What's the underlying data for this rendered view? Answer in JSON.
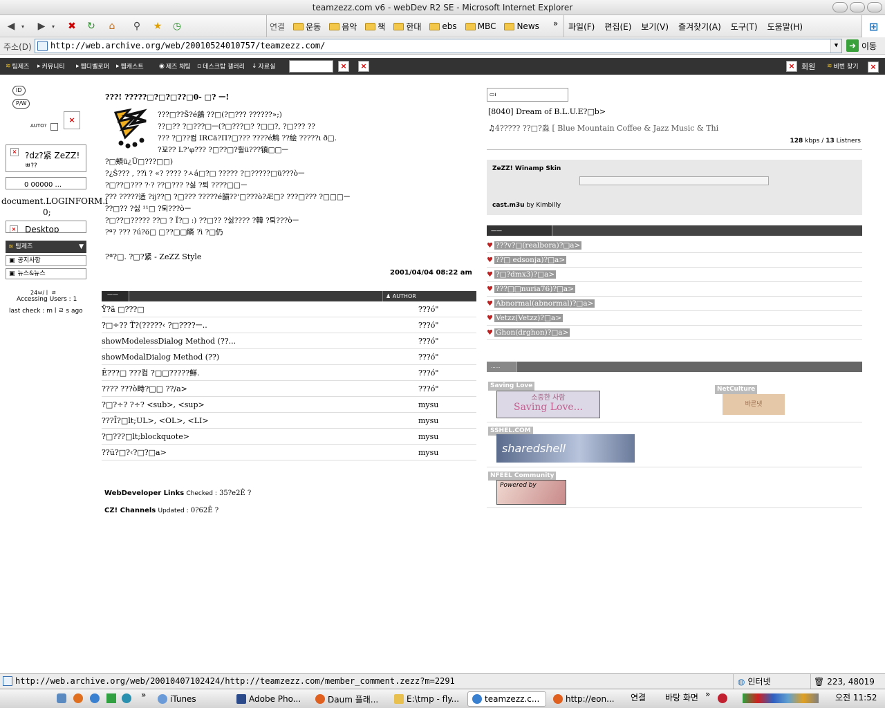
{
  "window": {
    "title": "teamzezz.com v6 - webDev R2 SE - Microsoft Internet Explorer"
  },
  "links_bar": {
    "label": "연결",
    "items": [
      "운동",
      "음악",
      "책",
      "한대",
      "ebs",
      "MBC",
      "News"
    ],
    "more": "»"
  },
  "menu": [
    "파일(F)",
    "편집(E)",
    "보기(V)",
    "즐겨찾기(A)",
    "도구(T)",
    "도움말(H)"
  ],
  "address": {
    "label": "주소(D)",
    "url": "http://web.archive.org/web/20010524010757/teamzezz.com/",
    "go": "이동"
  },
  "site_nav": {
    "items": [
      "팀제즈",
      "커뮤니티",
      "웹디벨로퍼",
      "웹캐스트",
      "제즈 채팅",
      "데스크탑 갤러리",
      "자료실"
    ],
    "member": "회원",
    "password": "비번 찾기"
  },
  "login": {
    "id": "ID",
    "pw": "P/W",
    "auto": "AUTO?",
    "box1": "?dz?紧 ZeZZ!",
    "box1_sub": "ㅃ??",
    "box2": "0 00000 ...",
    "script_text": "document.LOGINFORM.i",
    "script_text2": "0;",
    "box3": "Desktop"
  },
  "left_menu": {
    "header": "팀제즈",
    "items": [
      "공지사항",
      "뉴스&뉴스"
    ]
  },
  "stats": {
    "line1": "24ㅂ/ㅣ ㄹ",
    "accessing_label": "Accessing Users :",
    "accessing_value": "1",
    "lastcheck_label": "last check :",
    "lastcheck_value": "mㅣㄹ s ago"
  },
  "article": {
    "title": "???! ?????□?□?□??□0- □? ㅡ!",
    "lines": [
      "???□??Š?é鶬 ??□(?□??? ??????»;)",
      "??□?? ?□???□ㅡ(?□???□? ?□□?, ?□??? ??",
      "??? ?□??컴 IRCä?П?□??? ????é鹪 ??絵 ?????ı ð□.",
      "?꾜?? L?‘φ??? ?□??□?훨ü???镇□□ㅡ",
      "?□頬ü¿Ü□???□□)",
      "?¿Š???    , ??ì ? «? ???? ?ㅅá□?□ ????? ?□?????□ü???òㅡ",
      "?□??□??? ?·? ??□??? ?싫 ?퇴 ????□□ㅡ",
      "??? ?????适 ?ij??□ ?□??? ?????é韻??‘□???ò?Æ□? ???□??? ?□□□ㅡ",
      "??□?? ?싫 ¹¹□ ?퇴???òㅡ",
      "?□??□????? ??□ ? Ï?□ :) ??□?? ?싫???? ?韓 ?퇴???òㅡ",
      "?ª? ??? ?ú?ö□ □??□□瞵 ?ì    ?□仍"
    ],
    "sign": "?ª?□. ?□?紧 - ZeZZ Style",
    "date": "2001/04/04 08:22 am"
  },
  "comments": {
    "header_left": "——",
    "header_author": "AUTHOR",
    "rows": [
      {
        "title": "Ÿ?ä □???□",
        "author": "???ó\""
      },
      {
        "title": "?□÷?? Ť?(?????‹ ?□????ㅡ..",
        "author": "???ó\""
      },
      {
        "title": "showModelessDialog Method (??...",
        "author": "???ó\""
      },
      {
        "title": "showModalDialog Method (??)",
        "author": "???ó\""
      },
      {
        "title": "Ê???□  ???컴 ?□□?????鮮.",
        "author": "???ó\""
      },
      {
        "title": "????    ???ò畤?□□ ??/a>",
        "author": "???ó\""
      },
      {
        "title": "?□?÷? ?÷? <sub>, <sup>",
        "author": "mysu"
      },
      {
        "title": "???Î?□lt;UL>, <OL>, <LI>",
        "author": "mysu"
      },
      {
        "title": "?□???□lt;blockquote>",
        "author": "mysu"
      },
      {
        "title": "??ü?□?‹?□?□a>",
        "author": "mysu"
      }
    ]
  },
  "footer_links": {
    "wd_label": "WebDeveloper Links",
    "wd_checked": "Checked :",
    "wd_value": "35?e2Ê ?",
    "cz_label": "CZ! Channels",
    "cz_updated": "Updated :",
    "cz_value": "0?62Ê ?"
  },
  "music": {
    "song": "[8040] Dream of B.L.U.E?□b>",
    "station": "4????? ??□?淼 [ Blue Mountain Coffee & Jazz Music & Thi",
    "kbps": "128",
    "kbps_label": "kbps /",
    "listeners": "13",
    "listeners_label": "Listners"
  },
  "winamp": {
    "title": "ZeZZ! Winamp Skin",
    "file": "cast.m3u",
    "by": "by Kimbilly"
  },
  "people": {
    "header": "——",
    "items": [
      "???v?□(realbora)?□a>",
      "??□    edsonja)?□a>",
      "?□?dmx3)?□a>",
      "???□□nuria76)?□a>",
      "Abnormal(abnormal)?□a>",
      "Vetzz(Vetzz)?□a>",
      "Ghon(drghon)?□a>"
    ]
  },
  "banners": {
    "header": "......",
    "saving_love": "Saving Love",
    "saving_love_img": "Saving Love...",
    "saving_love_kr": "소중한 사람",
    "netculture": "NetCulture",
    "netculture_img": "바른넷",
    "sshel": "SSHEL.COM",
    "sshel_img": "sharedshell",
    "nfeel": "NFEEL Community",
    "nfeel_img": "Powered by"
  },
  "status": {
    "url": "http://web.archive.org/web/20010407102424/http://teamzezz.com/member_comment.zezz?m=2291",
    "zone": "인터넷",
    "coords": "223, 48019"
  },
  "taskbar": {
    "items": [
      "iTunes",
      "Adobe Pho...",
      "Daum 플래...",
      "E:\\tmp - fly...",
      "teamzezz.c...",
      "http://eon..."
    ],
    "links": "연결",
    "desktop": "바탕 화면",
    "more": "»",
    "clock": "오전 11:52"
  }
}
